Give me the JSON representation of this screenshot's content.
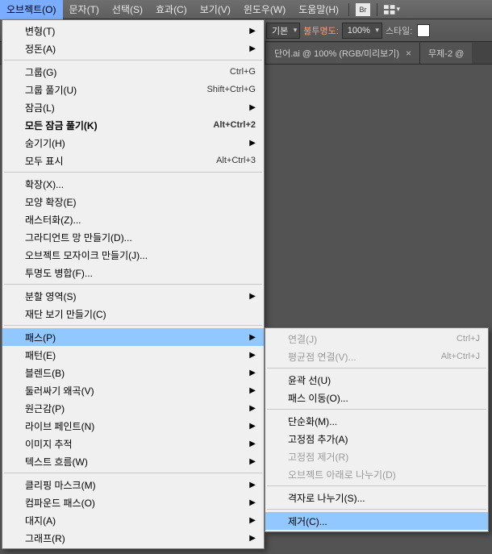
{
  "menubar": {
    "items": [
      "오브젝트(O)",
      "문자(T)",
      "선택(S)",
      "효과(C)",
      "보기(V)",
      "윈도우(W)",
      "도움말(H)"
    ],
    "br_label": "Br"
  },
  "toolbar": {
    "basic_label": "기본",
    "opacity_label": "불투명도:",
    "opacity_value": "100%",
    "style_label": "스타일:"
  },
  "tabs": [
    {
      "title": "단어.ai @ 100% (RGB/미리보기)"
    },
    {
      "title": "무제-2 @"
    }
  ],
  "object_menu": [
    {
      "type": "item",
      "label": "변형(T)",
      "arrow": true
    },
    {
      "type": "item",
      "label": "정돈(A)",
      "arrow": true
    },
    {
      "type": "sep"
    },
    {
      "type": "item",
      "label": "그룹(G)",
      "shortcut": "Ctrl+G"
    },
    {
      "type": "item",
      "label": "그룹 풀기(U)",
      "shortcut": "Shift+Ctrl+G"
    },
    {
      "type": "item",
      "label": "잠금(L)",
      "arrow": true
    },
    {
      "type": "item",
      "label": "모든 잠금 풀기(K)",
      "shortcut": "Alt+Ctrl+2",
      "bold": true
    },
    {
      "type": "item",
      "label": "숨기기(H)",
      "arrow": true
    },
    {
      "type": "item",
      "label": "모두 표시",
      "shortcut": "Alt+Ctrl+3"
    },
    {
      "type": "sep"
    },
    {
      "type": "item",
      "label": "확장(X)..."
    },
    {
      "type": "item",
      "label": "모양 확장(E)"
    },
    {
      "type": "item",
      "label": "래스터화(Z)..."
    },
    {
      "type": "item",
      "label": "그라디언트 망 만들기(D)..."
    },
    {
      "type": "item",
      "label": "오브젝트 모자이크 만들기(J)..."
    },
    {
      "type": "item",
      "label": "투명도 병합(F)..."
    },
    {
      "type": "sep"
    },
    {
      "type": "item",
      "label": "분할 영역(S)",
      "arrow": true
    },
    {
      "type": "item",
      "label": "재단 보기 만들기(C)"
    },
    {
      "type": "sep"
    },
    {
      "type": "item",
      "label": "패스(P)",
      "arrow": true,
      "highlighted": true
    },
    {
      "type": "item",
      "label": "패턴(E)",
      "arrow": true
    },
    {
      "type": "item",
      "label": "블렌드(B)",
      "arrow": true
    },
    {
      "type": "item",
      "label": "둘러싸기 왜곡(V)",
      "arrow": true
    },
    {
      "type": "item",
      "label": "원근감(P)",
      "arrow": true
    },
    {
      "type": "item",
      "label": "라이브 페인트(N)",
      "arrow": true
    },
    {
      "type": "item",
      "label": "이미지 추적",
      "arrow": true
    },
    {
      "type": "item",
      "label": "텍스트 흐름(W)",
      "arrow": true
    },
    {
      "type": "sep"
    },
    {
      "type": "item",
      "label": "클리핑 마스크(M)",
      "arrow": true
    },
    {
      "type": "item",
      "label": "컴파운드 패스(O)",
      "arrow": true
    },
    {
      "type": "item",
      "label": "대지(A)",
      "arrow": true
    },
    {
      "type": "item",
      "label": "그래프(R)",
      "arrow": true
    }
  ],
  "path_submenu": [
    {
      "type": "item",
      "label": "연결(J)",
      "shortcut": "Ctrl+J",
      "disabled": true
    },
    {
      "type": "item",
      "label": "평균점 연결(V)...",
      "shortcut": "Alt+Ctrl+J",
      "disabled": true
    },
    {
      "type": "sep"
    },
    {
      "type": "item",
      "label": "윤곽 선(U)"
    },
    {
      "type": "item",
      "label": "패스 이동(O)..."
    },
    {
      "type": "sep"
    },
    {
      "type": "item",
      "label": "단순화(M)..."
    },
    {
      "type": "item",
      "label": "고정점 추가(A)"
    },
    {
      "type": "item",
      "label": "고정점 제거(R)",
      "disabled": true
    },
    {
      "type": "item",
      "label": "오브젝트 아래로 나누기(D)",
      "disabled": true
    },
    {
      "type": "sep"
    },
    {
      "type": "item",
      "label": "격자로 나누기(S)..."
    },
    {
      "type": "sep"
    },
    {
      "type": "item",
      "label": "제거(C)...",
      "highlighted": true
    }
  ]
}
